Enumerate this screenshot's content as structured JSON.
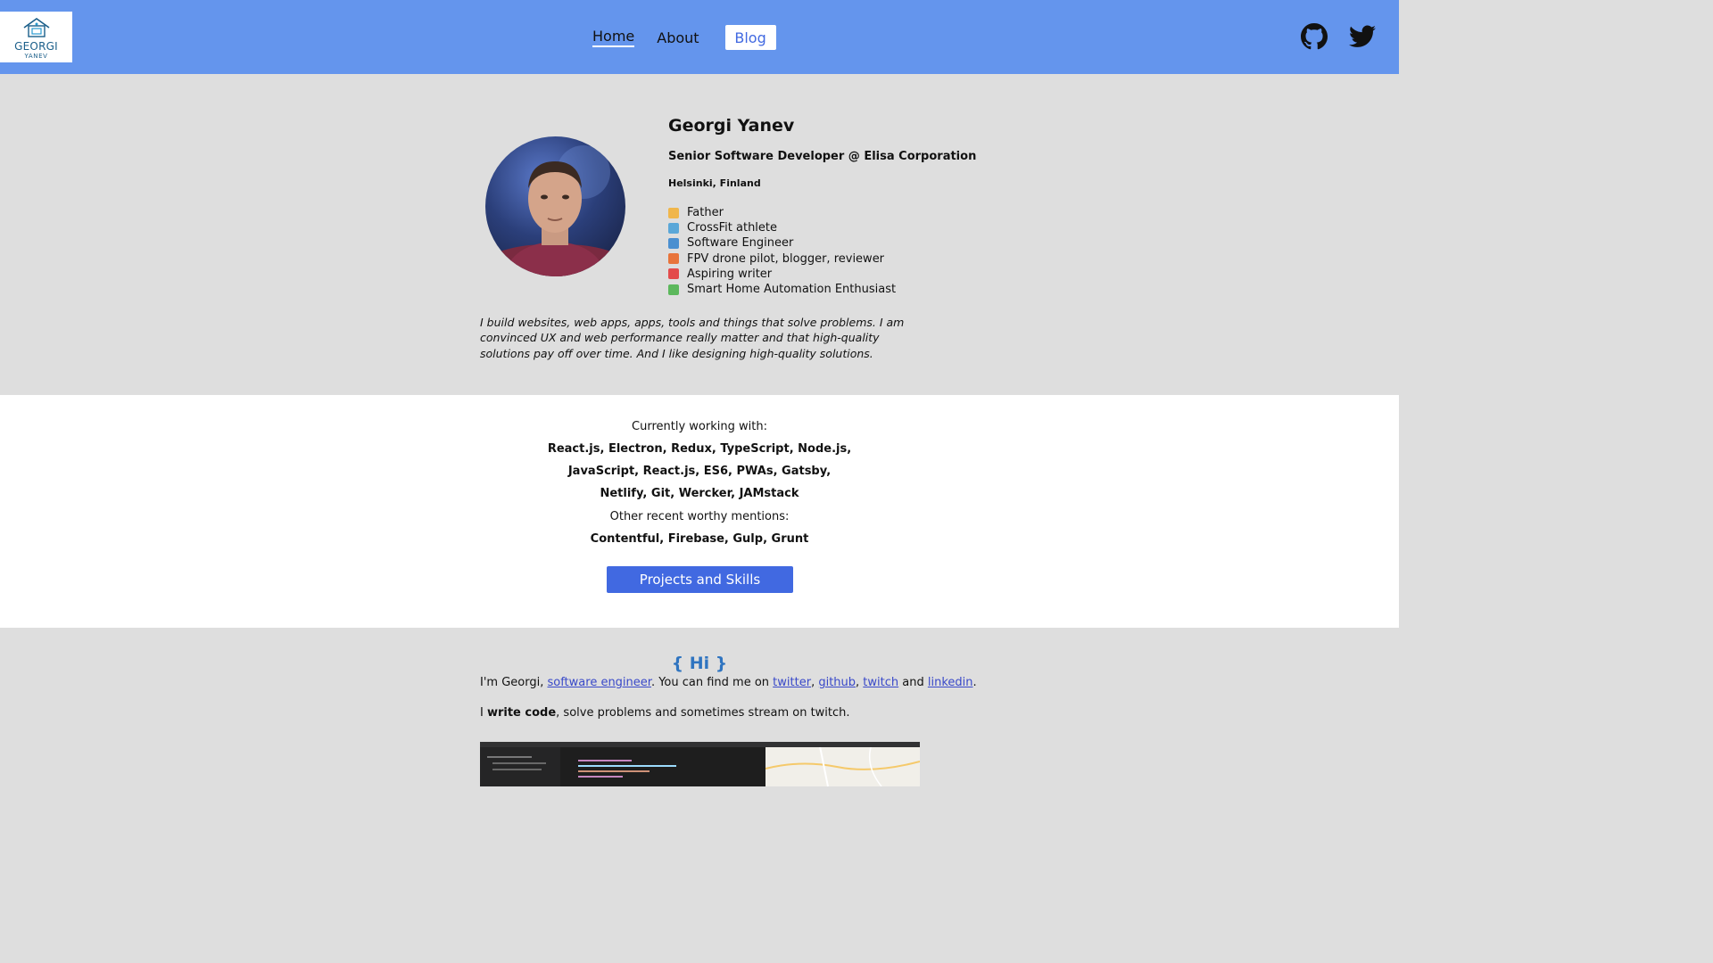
{
  "header": {
    "logo": {
      "line1": "GEORGI",
      "line2": "YANEV"
    },
    "nav": [
      {
        "label": "Home"
      },
      {
        "label": "About"
      },
      {
        "label": "Blog"
      }
    ],
    "social": [
      "github-icon",
      "twitter-icon"
    ]
  },
  "profile": {
    "name": "Georgi Yanev",
    "role": "Senior Software Developer @ Elisa Corporation",
    "location": "Helsinki, Finland",
    "traits": [
      {
        "icon": "person-icon",
        "label": "Father"
      },
      {
        "icon": "weightlifter-icon",
        "label": "CrossFit athlete"
      },
      {
        "icon": "computer-icon",
        "label": "Software Engineer"
      },
      {
        "icon": "drone-icon",
        "label": "FPV drone pilot, blogger, reviewer"
      },
      {
        "icon": "pencil-icon",
        "label": "Aspiring writer"
      },
      {
        "icon": "house-icon",
        "label": "Smart Home Automation Enthusiast"
      }
    ],
    "bio": "I build websites, web apps, apps, tools and things that solve problems. I am convinced UX and web performance really matter and that high-quality solutions pay off over time. And I like designing high-quality solutions."
  },
  "skills": {
    "working_label": "Currently working with:",
    "working_lines": [
      "React.js, Electron, Redux, TypeScript, Node.js,",
      "JavaScript, React.js, ES6, PWAs, Gatsby,",
      "Netlify, Git, Wercker, JAMstack"
    ],
    "other_label": "Other recent worthy mentions:",
    "other_line": "Contentful, Firebase, Gulp, Grunt",
    "button": "Projects and Skills"
  },
  "blog": {
    "heading": "{ Hi }",
    "intro": {
      "t1": "I'm Georgi, ",
      "link_role": "software engineer",
      "t2": ". You can find me on ",
      "link_twitter": "twitter",
      "sep1": ", ",
      "link_github": "github",
      "sep2": ", ",
      "link_twitch": "twitch",
      "t3": " and ",
      "link_linkedin": "linkedin",
      "t4": "."
    },
    "code_line": {
      "t1": "I ",
      "bold": "write code",
      "t2": ", solve problems and sometimes stream on twitch."
    }
  },
  "colors": {
    "navbar": "#6495ed",
    "button": "#4169e1",
    "heading": "#2f74c0",
    "link": "#3949c9"
  }
}
